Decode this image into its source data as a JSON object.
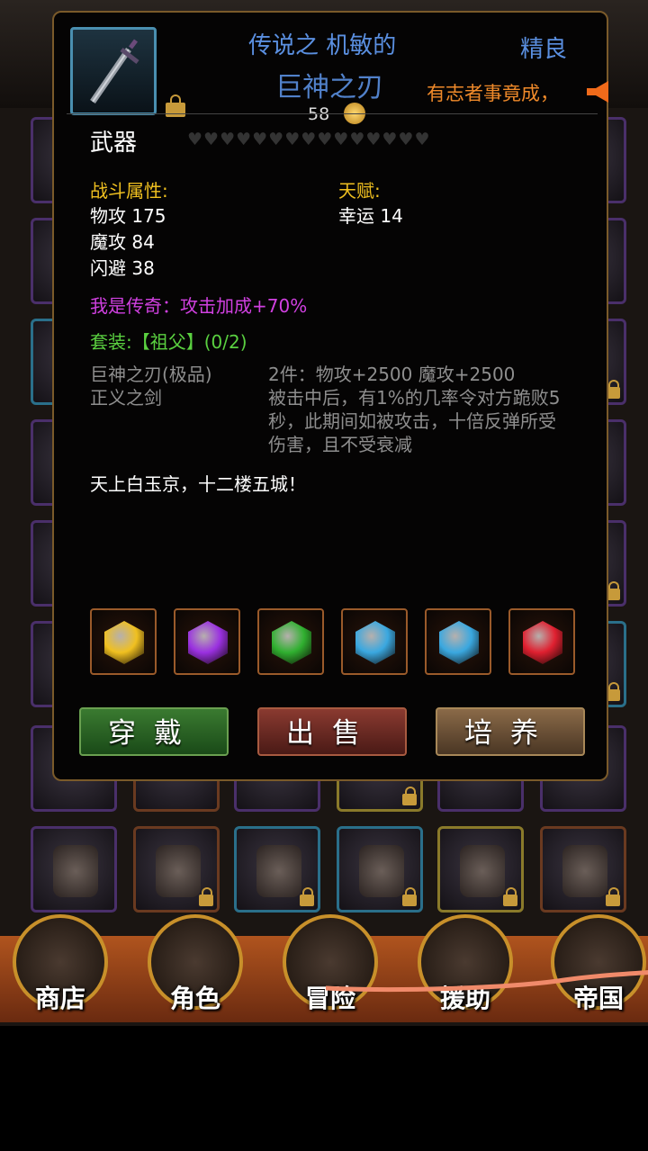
{
  "item": {
    "prefix": "传说之 机敏的",
    "name": "巨神之刃",
    "quality": "精良",
    "price": "58",
    "category": "武器",
    "hearts": "♥♥♥♥♥♥♥♥♥♥♥♥♥♥♥",
    "weapon_icon": "sword-icon"
  },
  "banner_text": "有志者事竟成，",
  "combat": {
    "heading": "战斗属性:",
    "stats": [
      "物攻 175",
      "魔攻 84",
      "闪避 38"
    ]
  },
  "talent": {
    "heading": "天赋:",
    "stats": [
      "幸运 14"
    ]
  },
  "legend_line": "我是传奇：攻击加成+70%",
  "set": {
    "heading": "套装:【祖父】(0/2)",
    "pieces": [
      "巨神之刃(极品)",
      "正义之剑"
    ],
    "bonus_line1": "2件：物攻+2500 魔攻+2500",
    "bonus_desc": [
      "被击中后，有1%的几率令对方跪败5",
      "秒，此期间如被攻击，十倍反弹所受",
      "伤害，且不受衰减"
    ]
  },
  "flavor": "天上白玉京，十二楼五城！",
  "gems": [
    {
      "name": "gold-gem",
      "color": "#f0c020"
    },
    {
      "name": "purple-gem",
      "color": "#9a30e0"
    },
    {
      "name": "green-gem",
      "color": "#30b030"
    },
    {
      "name": "blue-gem",
      "color": "#3aa8e0"
    },
    {
      "name": "blue-gem",
      "color": "#3aa8e0"
    },
    {
      "name": "red-gem",
      "color": "#e02030"
    }
  ],
  "buttons": {
    "wear": "穿戴",
    "sell": "出售",
    "train": "培养"
  },
  "nav": [
    "商店",
    "角色",
    "冒险",
    "援助",
    "帝国"
  ],
  "colors": {
    "title_blue": "#5a8fe0",
    "stat_gold": "#f0c020",
    "legend_purple": "#d040e0",
    "set_green": "#5ad040",
    "banner_orange": "#f08a2a"
  }
}
